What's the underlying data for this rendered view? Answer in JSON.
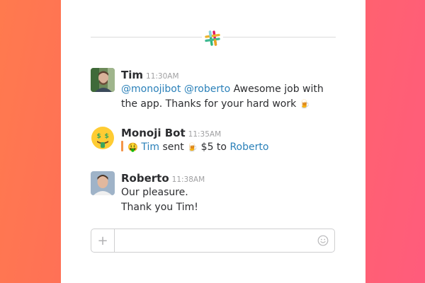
{
  "app": {
    "logo_icon": "slack-logo-icon",
    "accent_color": "#2a80b9",
    "background_left": "#ff7a4e",
    "background_right": "#ff5c7c"
  },
  "messages": [
    {
      "author": "Tim",
      "time": "11:30AM",
      "line1": {
        "mention1": "@monojibot",
        "mention2": "@roberto",
        "text": "Awesome job with"
      },
      "line2": {
        "text": "the app. Thanks for your hard work",
        "emoji": "🍺"
      }
    },
    {
      "author": "Monoji Bot",
      "time": "11:35AM",
      "avatar_emoji": "🤑",
      "line1": {
        "emoji1": "🤑",
        "user": "Tim",
        "sent": "sent",
        "emoji2": "🍺",
        "amount": "$5 to",
        "recipient": "Roberto"
      }
    },
    {
      "author": "Roberto",
      "time": "11:38AM",
      "line1": "Our pleasure.",
      "line2": "Thank you Tim!"
    }
  ],
  "composer": {
    "plus_label": "+",
    "value": "",
    "placeholder": "",
    "emoji_icon": "smiley-icon"
  }
}
